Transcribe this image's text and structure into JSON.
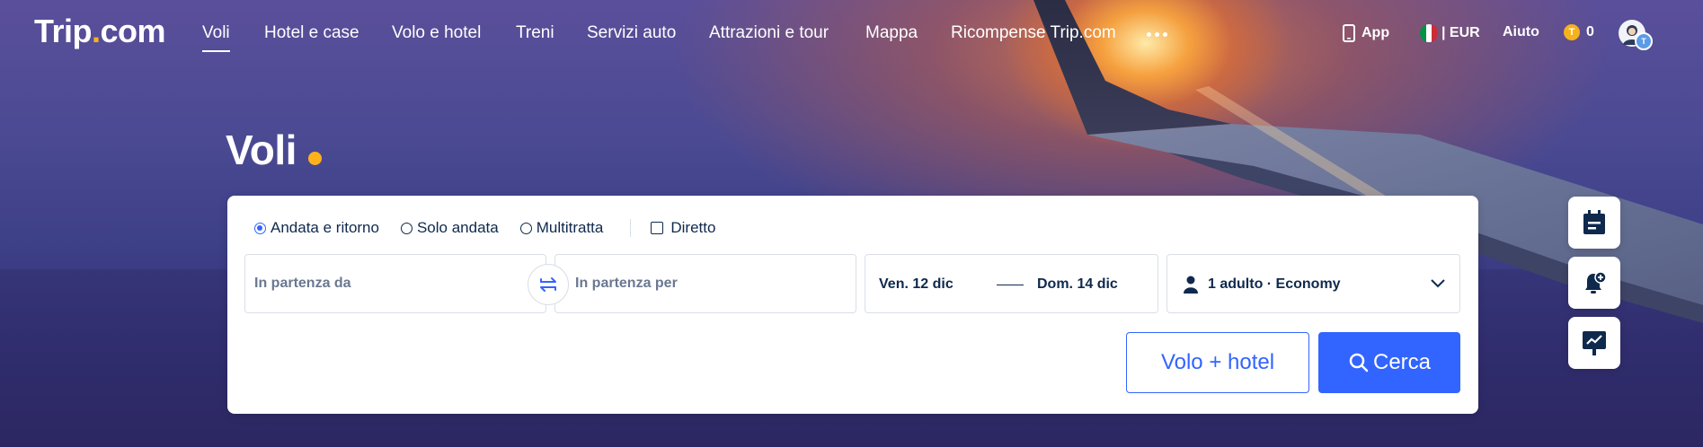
{
  "brand": {
    "name": "Trip",
    "dot": ".",
    "suffix": "com",
    "accent": "#ffb21c",
    "primary": "#3264ff"
  },
  "nav": {
    "items": [
      {
        "label": "Voli",
        "active": true
      },
      {
        "label": "Hotel e case"
      },
      {
        "label": "Volo e hotel"
      },
      {
        "label": "Treni"
      },
      {
        "label": "Servizi auto"
      },
      {
        "label": "Attrazioni e tour"
      },
      {
        "label": "Mappa"
      },
      {
        "label": "Ricompense Trip.com"
      }
    ],
    "app_label": "App",
    "currency": "| EUR",
    "help": "Aiuto",
    "coins": "0"
  },
  "page": {
    "title": "Voli"
  },
  "search": {
    "trip_types": [
      {
        "label": "Andata e ritorno",
        "checked": true
      },
      {
        "label": "Solo andata",
        "checked": false
      },
      {
        "label": "Multitratta",
        "checked": false
      }
    ],
    "direct_label": "Diretto",
    "from_placeholder": "In partenza da",
    "to_placeholder": "In partenza per",
    "depart_date": "Ven. 12 dic",
    "return_date": "Dom. 14 dic",
    "passengers": "1 adulto · Economy",
    "combo_button": "Volo + hotel",
    "search_button": "Cerca"
  },
  "side_buttons": [
    "calendar-icon",
    "price-alert-icon",
    "price-trend-icon"
  ]
}
